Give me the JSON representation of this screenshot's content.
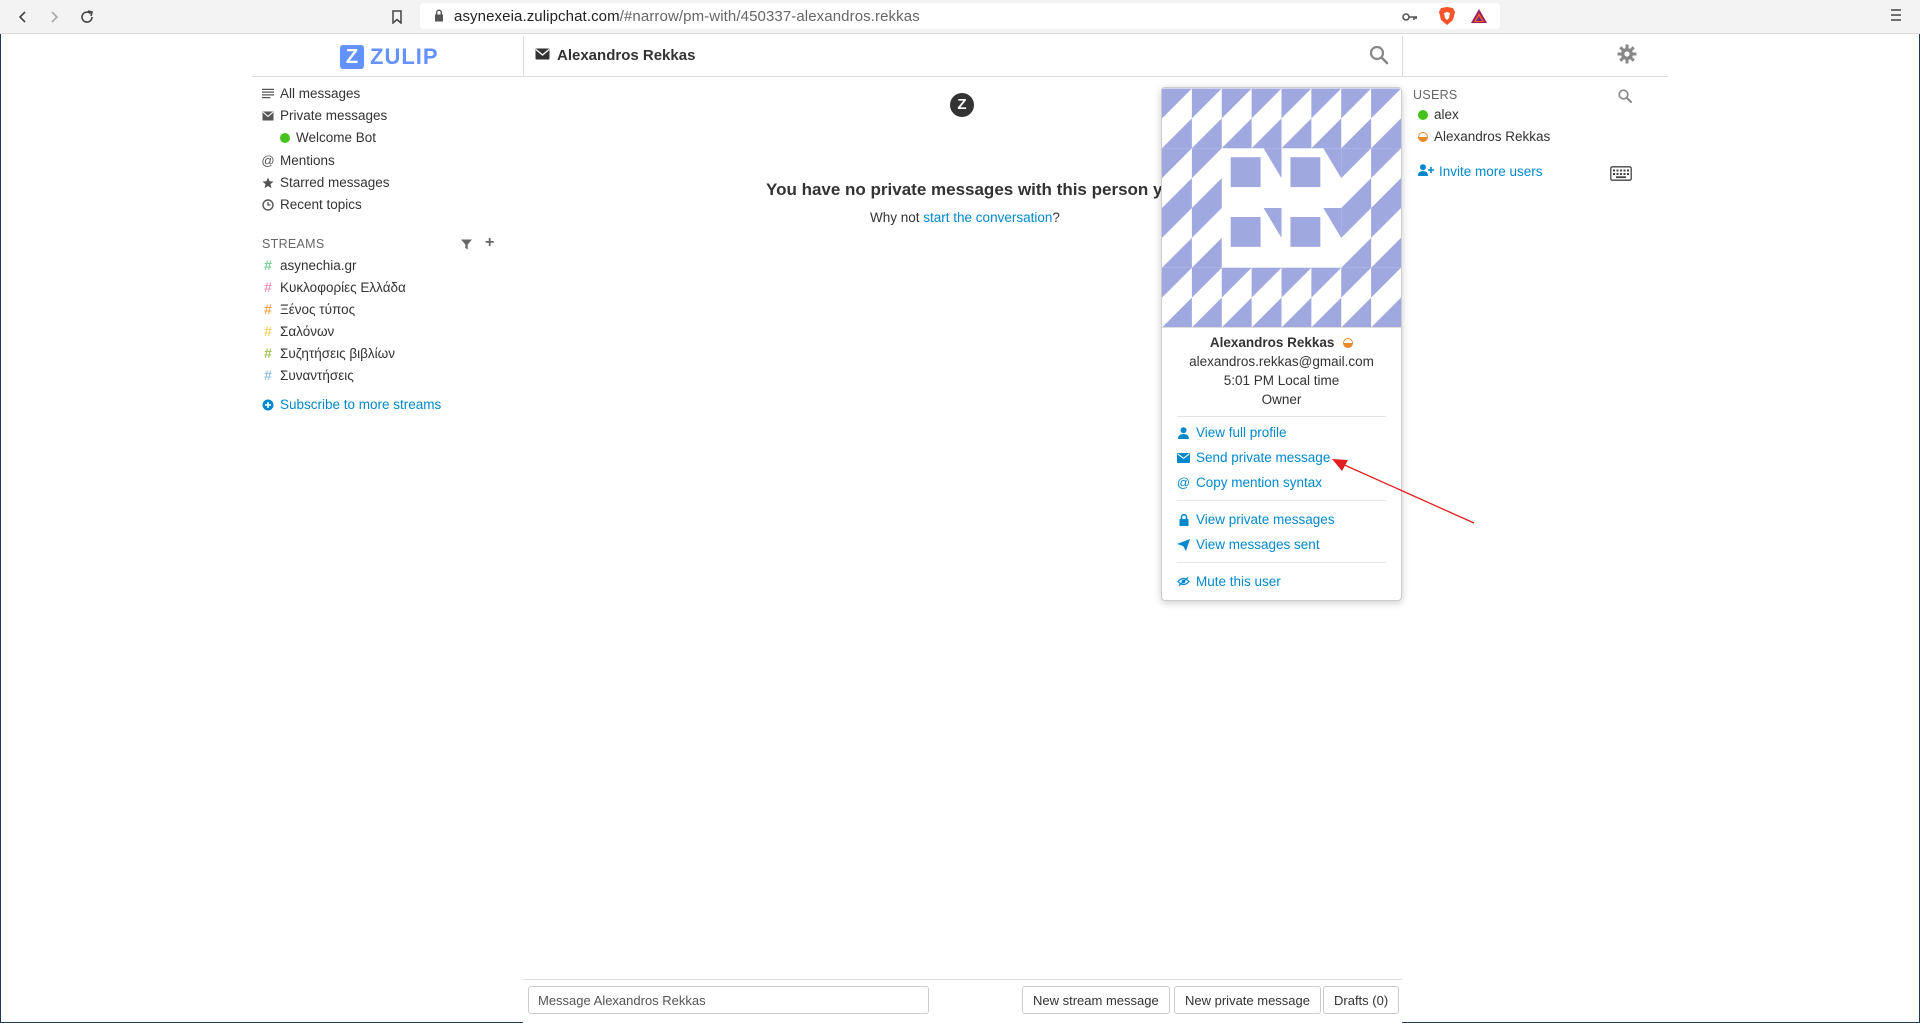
{
  "browser": {
    "url_host": "asynexeia.zulipchat.com",
    "url_path": "/#narrow/pm-with/450337-alexandros.rekkas"
  },
  "header": {
    "logo_text": "ZULIP",
    "narrow_title": "Alexandros Rekkas"
  },
  "left_sidebar": {
    "items": [
      {
        "label": "All messages",
        "icon": "list-icon"
      },
      {
        "label": "Private messages",
        "icon": "envelope-icon"
      },
      {
        "label": "Welcome Bot",
        "icon": "online-dot"
      },
      {
        "label": "Mentions",
        "icon": "at-icon"
      },
      {
        "label": "Starred messages",
        "icon": "star-icon"
      },
      {
        "label": "Recent topics",
        "icon": "clock-icon"
      }
    ],
    "streams_header": "STREAMS",
    "streams": [
      {
        "name": "asynechia.gr",
        "color": "#76ce90"
      },
      {
        "name": "Κυκλοφορίες Ελλάδα",
        "color": "#e79ab5"
      },
      {
        "name": "Ξένος τύπος",
        "color": "#f5a34b"
      },
      {
        "name": "Σαλόνων",
        "color": "#f6d46e"
      },
      {
        "name": "Συζητήσεις βιβλίων",
        "color": "#a6c553"
      },
      {
        "name": "Συναντήσεις",
        "color": "#94c1e8"
      }
    ],
    "subscribe_link": "Subscribe to more streams"
  },
  "center": {
    "empty_title": "You have no private messages with this person yet!",
    "empty_prefix": "Why not ",
    "empty_link": "start the conversation",
    "empty_suffix": "?"
  },
  "popover": {
    "name": "Alexandros Rekkas",
    "email": "alexandros.rekkas@gmail.com",
    "local_time": "5:01 PM Local time",
    "role": "Owner",
    "avatar_color": "#a0a8e0",
    "actions": [
      {
        "label": "View full profile",
        "icon": "user-icon"
      },
      {
        "label": "Send private message",
        "icon": "envelope-icon"
      },
      {
        "label": "Copy mention syntax",
        "icon": "at-icon"
      },
      {
        "label": "View private messages",
        "icon": "lock-icon"
      },
      {
        "label": "View messages sent",
        "icon": "paper-plane-icon"
      },
      {
        "label": "Mute this user",
        "icon": "eye-slash-icon"
      }
    ]
  },
  "right_sidebar": {
    "users_header": "USERS",
    "users": [
      {
        "name": "alex",
        "status": "active"
      },
      {
        "name": "Alexandros Rekkas",
        "status": "idle"
      }
    ],
    "invite_link": "Invite more users"
  },
  "compose": {
    "placeholder": "Message Alexandros Rekkas",
    "new_stream_btn": "New stream message",
    "new_pm_btn": "New private message",
    "drafts_btn": "Drafts (0)"
  },
  "colors": {
    "link": "#0088cc",
    "brand": "#6492fd",
    "annotation": "#e02020"
  }
}
